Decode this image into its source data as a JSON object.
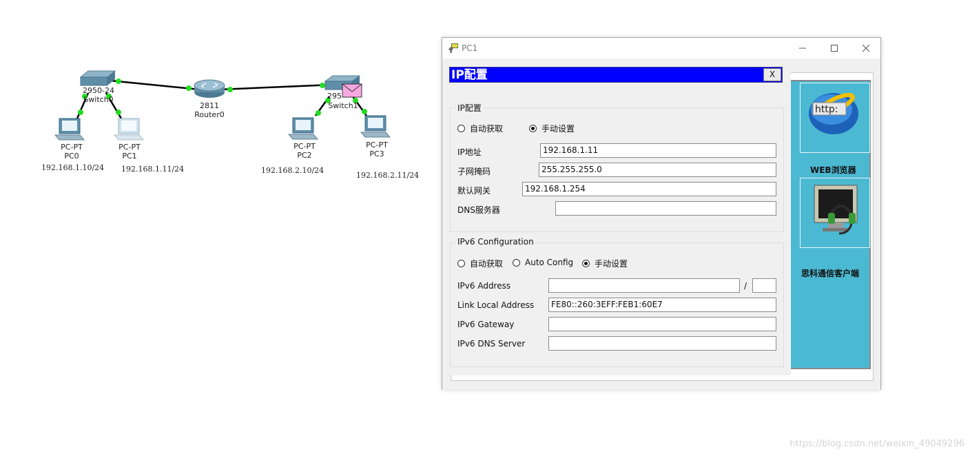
{
  "topology": {
    "devices": [
      {
        "id": "switch0",
        "model": "2950-24",
        "name": "Switch0"
      },
      {
        "id": "router0",
        "model": "2811",
        "name": "Router0"
      },
      {
        "id": "switch1",
        "model": "2950-24",
        "model_visible": "295",
        "name": "Switch1"
      },
      {
        "id": "pc0",
        "type": "PC-PT",
        "name": "PC0",
        "ip": "192.168.1.10/24"
      },
      {
        "id": "pc1",
        "type": "PC-PT",
        "name": "PC1",
        "ip": "192.168.1.11/24"
      },
      {
        "id": "pc2",
        "type": "PC-PT",
        "name": "PC2",
        "ip": "192.168.2.10/24"
      },
      {
        "id": "pc3",
        "type": "PC-PT",
        "name": "PC3",
        "ip": "192.168.2.11/24"
      }
    ],
    "link_color": "#000000",
    "port_color": "#22dd22"
  },
  "window": {
    "title": "PC1",
    "minimize_icon": "minimize-icon",
    "maximize_icon": "maximize-icon",
    "close_icon": "close-icon"
  },
  "desktop": {
    "background": "#4cb9d2",
    "apps": [
      {
        "label": "WEB浏览器",
        "icon": "web-browser-icon",
        "icon_text": "http:"
      },
      {
        "label": "思科通信客户端",
        "icon": "cisco-communicator-icon"
      }
    ]
  },
  "ip_config": {
    "title": "IP配置",
    "close_label": "X",
    "ipv4": {
      "legend": "IP配置",
      "dhcp_label": "自动获取",
      "static_label": "手动设置",
      "mode": "static",
      "ip_label": "IP地址",
      "ip_value": "192.168.1.11",
      "mask_label": "子网掩码",
      "mask_value": "255.255.255.0",
      "gateway_label": "默认网关",
      "gateway_value": "192.168.1.254",
      "dns_label": "DNS服务器",
      "dns_value": ""
    },
    "ipv6": {
      "legend": "IPv6 Configuration",
      "dhcp_label": "自动获取",
      "auto_label": "Auto Config",
      "static_label": "手动设置",
      "mode": "static",
      "address_label": "IPv6 Address",
      "address_value": "",
      "prefix_separator": "/",
      "prefix_value": "",
      "link_local_label": "Link Local Address",
      "link_local_value": "FE80::260:3EFF:FEB1:60E7",
      "gateway_label": "IPv6 Gateway",
      "gateway_value": "",
      "dns_label": "IPv6 DNS Server",
      "dns_value": ""
    },
    "header_color": "#0000ff"
  },
  "watermark": "https://blog.csdn.net/weixin_49049296"
}
